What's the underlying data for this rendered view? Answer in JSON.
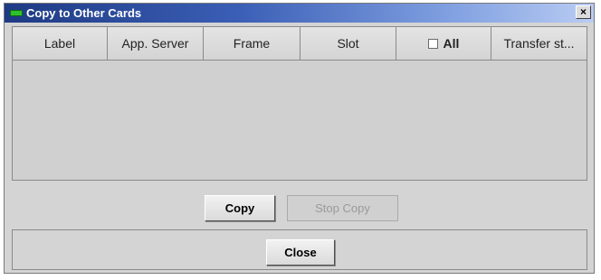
{
  "window": {
    "title": "Copy to Other Cards",
    "close_glyph": "×",
    "title_icon": "green-card-icon",
    "title_gradient": [
      "#1e3a84",
      "#b9ccf3"
    ]
  },
  "table": {
    "columns": [
      {
        "label": "Label"
      },
      {
        "label": "App. Server"
      },
      {
        "label": "Frame"
      },
      {
        "label": "Slot"
      },
      {
        "label": "All",
        "checkbox": true,
        "checked": false
      },
      {
        "label": "Transfer st..."
      }
    ],
    "rows": []
  },
  "actions": {
    "copy_label": "Copy",
    "stop_copy_label": "Stop Copy",
    "stop_copy_enabled": false,
    "close_label": "Close"
  }
}
